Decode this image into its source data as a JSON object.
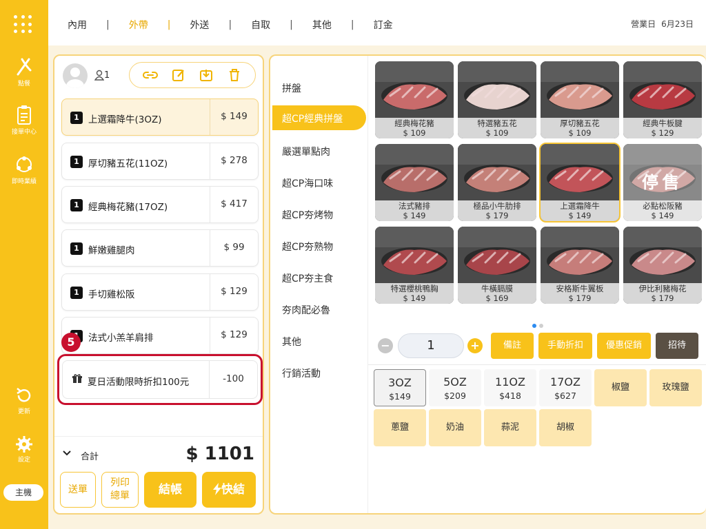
{
  "rail": {
    "items": [
      {
        "label": "點餐",
        "icon": "order-icon"
      },
      {
        "label": "接單中心",
        "icon": "clipboard-icon"
      },
      {
        "label": "即時業績",
        "icon": "sync-people-icon"
      },
      {
        "label": "更新",
        "icon": "refresh-icon"
      },
      {
        "label": "設定",
        "icon": "gear-icon"
      }
    ],
    "host": "主機"
  },
  "top_tabs": [
    {
      "label": "內用",
      "active": false
    },
    {
      "label": "外帶",
      "active": true
    },
    {
      "label": "外送",
      "active": false
    },
    {
      "label": "自取",
      "active": false
    },
    {
      "label": "其他",
      "active": false
    },
    {
      "label": "訂金",
      "active": false
    }
  ],
  "business_day": {
    "label": "營業日",
    "date": "6月23日"
  },
  "order": {
    "guest_count": "1",
    "items": [
      {
        "qty": "1",
        "name": "上選霜降牛(3OZ)",
        "price": "$ 149",
        "selected": true
      },
      {
        "qty": "1",
        "name": "厚切豬五花(11OZ)",
        "price": "$ 278",
        "selected": false
      },
      {
        "qty": "1",
        "name": "經典梅花豬(17OZ)",
        "price": "$ 417",
        "selected": false
      },
      {
        "qty": "1",
        "name": "鮮嫩雞腿肉",
        "price": "$ 99",
        "selected": false
      },
      {
        "qty": "1",
        "name": "手切雞松阪",
        "price": "$ 129",
        "selected": false
      },
      {
        "qty": "1",
        "name": "法式小羔羊肩排",
        "price": "$ 129",
        "selected": false
      }
    ],
    "promo": {
      "name": "夏日活動限時折扣100元",
      "price": "-100"
    },
    "step_badge": "5",
    "total_label": "合計",
    "total_amount": "$ 1101",
    "buttons": {
      "send": "送單",
      "print_line1": "列印",
      "print_line2": "總單",
      "checkout": "結帳",
      "quick": "快結"
    }
  },
  "categories": [
    {
      "label": "拼盤",
      "active": false
    },
    {
      "label": "超CP經典拼盤",
      "active": true
    },
    {
      "label": "嚴選單點肉",
      "active": false
    },
    {
      "label": "超CP海口味",
      "active": false
    },
    {
      "label": "超CP夯烤物",
      "active": false
    },
    {
      "label": "超CP夯熟物",
      "active": false
    },
    {
      "label": "超CP夯主食",
      "active": false
    },
    {
      "label": "夯肉配必魯",
      "active": false
    },
    {
      "label": "其他",
      "active": false
    },
    {
      "label": "行銷活動",
      "active": false
    }
  ],
  "products": [
    {
      "name": "經典梅花豬",
      "price": "$ 109",
      "color": "#c96b6b",
      "sold": false,
      "selected": false
    },
    {
      "name": "特選豬五花",
      "price": "$ 109",
      "color": "#e7d3cf",
      "sold": false,
      "selected": false
    },
    {
      "name": "厚切豬五花",
      "price": "$ 109",
      "color": "#d99a8e",
      "sold": false,
      "selected": false
    },
    {
      "name": "經典牛板腱",
      "price": "$ 129",
      "color": "#b83a42",
      "sold": false,
      "selected": false
    },
    {
      "name": "法式豬排",
      "price": "$ 149",
      "color": "#b86e6a",
      "sold": false,
      "selected": false
    },
    {
      "name": "極品小牛肋排",
      "price": "$ 179",
      "color": "#c48078",
      "sold": false,
      "selected": false
    },
    {
      "name": "上選霜降牛",
      "price": "$ 149",
      "color": "#c25459",
      "sold": false,
      "selected": true
    },
    {
      "name": "必點松阪豬",
      "price": "$ 149",
      "color": "#b87a76",
      "sold": true,
      "selected": false,
      "sold_label": "停售"
    },
    {
      "name": "特選櫻桃鴨胸",
      "price": "$ 149",
      "color": "#b04a4e",
      "sold": false,
      "selected": false
    },
    {
      "name": "牛橫膈膜",
      "price": "$ 169",
      "color": "#a8454a",
      "sold": false,
      "selected": false
    },
    {
      "name": "安格斯牛翼板",
      "price": "$ 179",
      "color": "#c67d7a",
      "sold": false,
      "selected": false
    },
    {
      "name": "伊比利豬梅花",
      "price": "$ 179",
      "color": "#c9898a",
      "sold": false,
      "selected": false
    }
  ],
  "quantity": {
    "value": "1",
    "buttons": [
      "備註",
      "手動折扣",
      "優惠促銷",
      "招待"
    ]
  },
  "options": {
    "sizes": [
      {
        "label": "3OZ",
        "price": "$149",
        "selected": true
      },
      {
        "label": "5OZ",
        "price": "$209",
        "selected": false
      },
      {
        "label": "11OZ",
        "price": "$418",
        "selected": false
      },
      {
        "label": "17OZ",
        "price": "$627",
        "selected": false
      }
    ],
    "flavors": [
      "椒鹽",
      "玫瑰鹽",
      "蔥鹽",
      "奶油",
      "蒜泥",
      "胡椒"
    ]
  },
  "colors": {
    "accent": "#f8c21a",
    "highlight": "#c8102e",
    "panel_border": "#f7d47a"
  }
}
